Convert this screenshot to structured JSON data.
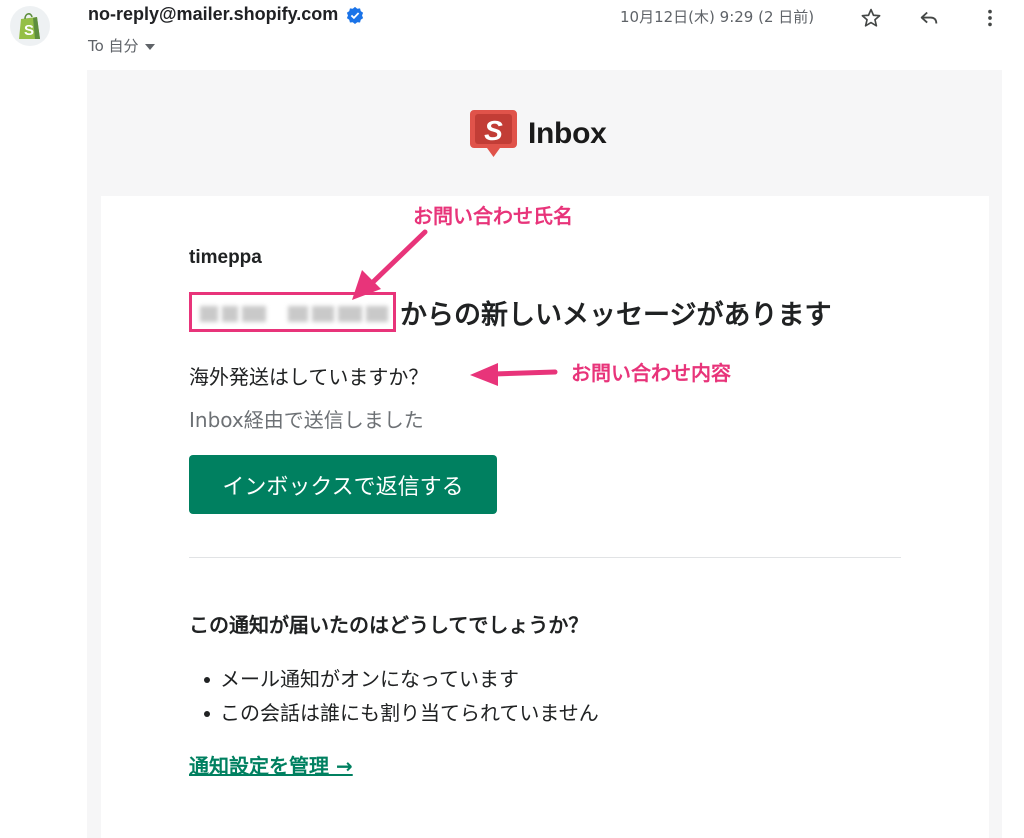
{
  "header": {
    "sender": "no-reply@mailer.shopify.com",
    "to_label": "To 自分",
    "date": "10月12日(木) 9:29 (2 日前)",
    "icons": {
      "avatar": "shopify-bag-icon",
      "verified": "verified-badge-icon",
      "star": "star-icon",
      "reply": "reply-icon",
      "more": "more-vertical-icon"
    }
  },
  "brand": {
    "logo_letter": "S",
    "name": "Inbox",
    "logo_color": "#e0534a"
  },
  "email": {
    "shop_name": "timeppa",
    "headline_suffix": "からの新しいメッセージがあります",
    "message": "海外発送はしていますか？",
    "via": "Inbox経由で送信しました",
    "reply_button": "インボックスで返信する",
    "why_title": "この通知が届いたのはどうしてでしょうか？",
    "reasons": [
      "メール通知がオンになっています",
      "この会話は誰にも割り当てられていません"
    ],
    "manage_link": "通知設定を管理 →"
  },
  "annotations": {
    "name_label": "お問い合わせ氏名",
    "content_label": "お問い合わせ内容",
    "color": "#e8347a"
  },
  "colors": {
    "accent_green": "#008060",
    "body_bg": "#f6f6f7"
  }
}
